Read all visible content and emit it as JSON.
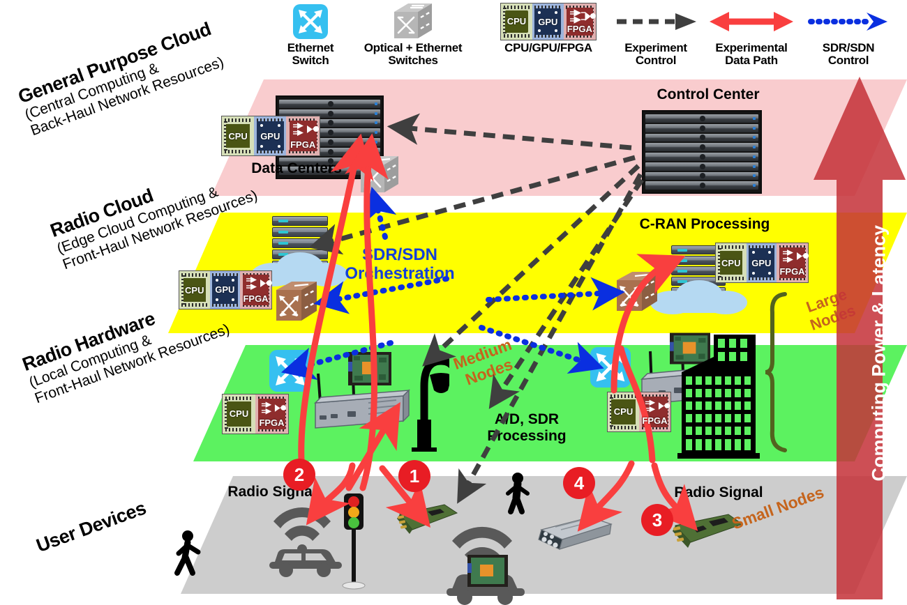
{
  "legend": {
    "items": [
      {
        "icon": "ethernet-switch-icon",
        "label": "Ethernet\nSwitch"
      },
      {
        "icon": "optical-ethernet-switch-icon",
        "label": "Optical + Ethernet\nSwitches"
      },
      {
        "icon": "cpu-gpu-fpga-icon",
        "label": "CPU/GPU/FPGA"
      },
      {
        "icon": "dashed-black-arrow-icon",
        "label": "Experiment\nControl"
      },
      {
        "icon": "red-double-arrow-icon",
        "label": "Experimental\nData Path"
      },
      {
        "icon": "blue-dotted-arrow-icon",
        "label": "SDR/SDN\nControl"
      }
    ]
  },
  "layers": [
    {
      "id": "general-purpose-cloud",
      "title": "General Purpose Cloud",
      "sub1": "(Central Computing &",
      "sub2": "Back-Haul Network Resources)",
      "color": "#f9ccce"
    },
    {
      "id": "radio-cloud",
      "title": "Radio Cloud",
      "sub1": "(Edge Cloud Computing &",
      "sub2": "Front-Haul Network Resources)",
      "color": "#ffff00"
    },
    {
      "id": "radio-hardware",
      "title": "Radio Hardware",
      "sub1": "(Local Computing &",
      "sub2": "Front-Haul Network Resources)",
      "color": "#5cf260"
    },
    {
      "id": "user-devices",
      "title": "User Devices",
      "sub1": "",
      "sub2": "",
      "color": "#cdcdcd"
    }
  ],
  "chips": {
    "cpu": "CPU",
    "gpu": "GPU",
    "fpga": "FPGA"
  },
  "annotations": {
    "data_centers": "Data Centers",
    "control_center": "Control Center",
    "sdr_sdn_orchestration": "SDR/SDN\nOrchestration",
    "cran_processing": "C-RAN Processing",
    "ad_sdr_processing": "A/D, SDR\nProcessing",
    "large_nodes": "Large\nNodes",
    "medium_nodes": "Medium\nNodes",
    "small_nodes": "Small Nodes",
    "radio_signal_left": "Radio Signal",
    "radio_signal_right": "Radio Signal",
    "vertical_arrow": "Computing Power & Latency"
  },
  "markers": [
    {
      "id": "marker-1",
      "number": "1"
    },
    {
      "id": "marker-2",
      "number": "2"
    },
    {
      "id": "marker-3",
      "number": "3"
    },
    {
      "id": "marker-4",
      "number": "4"
    }
  ],
  "colors": {
    "cloud_pink": "#f9ccce",
    "radio_cloud_yellow": "#ffff00",
    "radio_hardware_green": "#5cf260",
    "user_devices_gray": "#cdcdcd",
    "data_path_red": "#f93f3f",
    "control_black": "#3f3f3f",
    "sdn_blue": "#1440d8",
    "marker_red": "#e81d24",
    "orange_text": "#c5641c",
    "big_arrow_red": "#c5333a"
  }
}
